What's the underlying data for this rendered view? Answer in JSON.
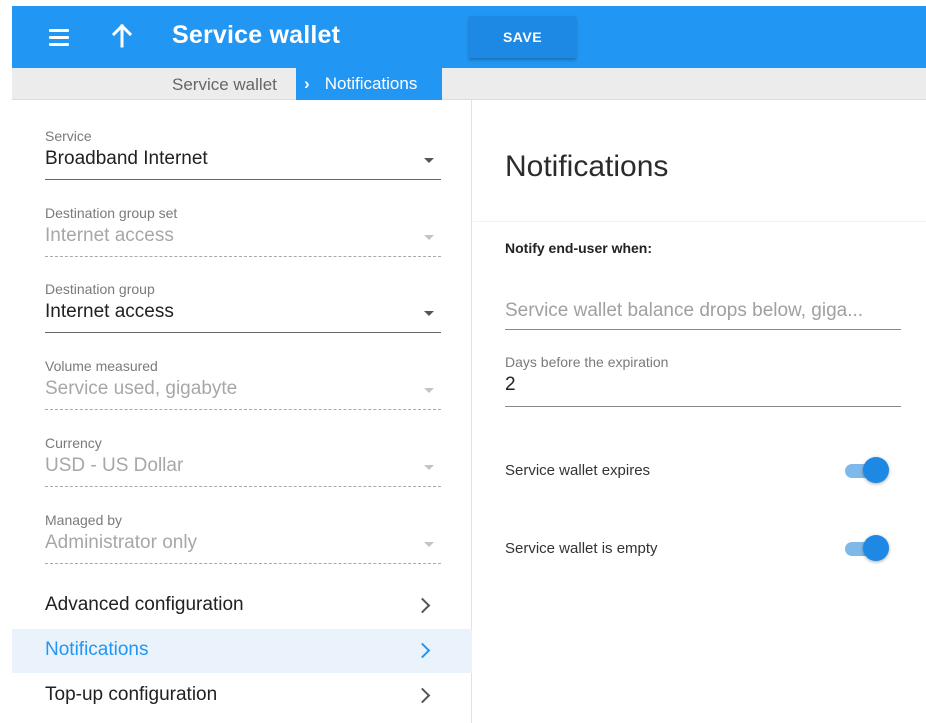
{
  "header": {
    "menu_icon": "menu-icon",
    "up_icon": "arrow-up-icon",
    "title": "Service wallet",
    "save_label": "SAVE",
    "color": "#2196f3"
  },
  "breadcrumb": {
    "root": "Service wallet",
    "current": "Notifications",
    "separator_icon": "chevron-right-icon"
  },
  "form": {
    "service": {
      "label": "Service",
      "value": "Broadband Internet"
    },
    "destination_group_set": {
      "label": "Destination group set",
      "value": "Internet access"
    },
    "destination_group": {
      "label": "Destination group",
      "value": "Internet access"
    },
    "volume_measured": {
      "label": "Volume measured",
      "value": "Service used, gigabyte"
    },
    "currency": {
      "label": "Currency",
      "value": "USD - US Dollar"
    },
    "managed_by": {
      "label": "Managed by",
      "value": "Administrator only"
    }
  },
  "nav": [
    {
      "label": "Advanced configuration"
    },
    {
      "label": "Notifications",
      "active": true
    },
    {
      "label": "Top-up configuration"
    }
  ],
  "notifications": {
    "title": "Notifications",
    "notify_label": "Notify end-user when:",
    "balance_placeholder": "Service wallet balance drops below, giga...",
    "days_label": "Days before the expiration",
    "days_value": "2",
    "toggle_expires": {
      "label": "Service wallet expires",
      "on": true
    },
    "toggle_empty": {
      "label": "Service wallet is empty",
      "on": true
    }
  }
}
